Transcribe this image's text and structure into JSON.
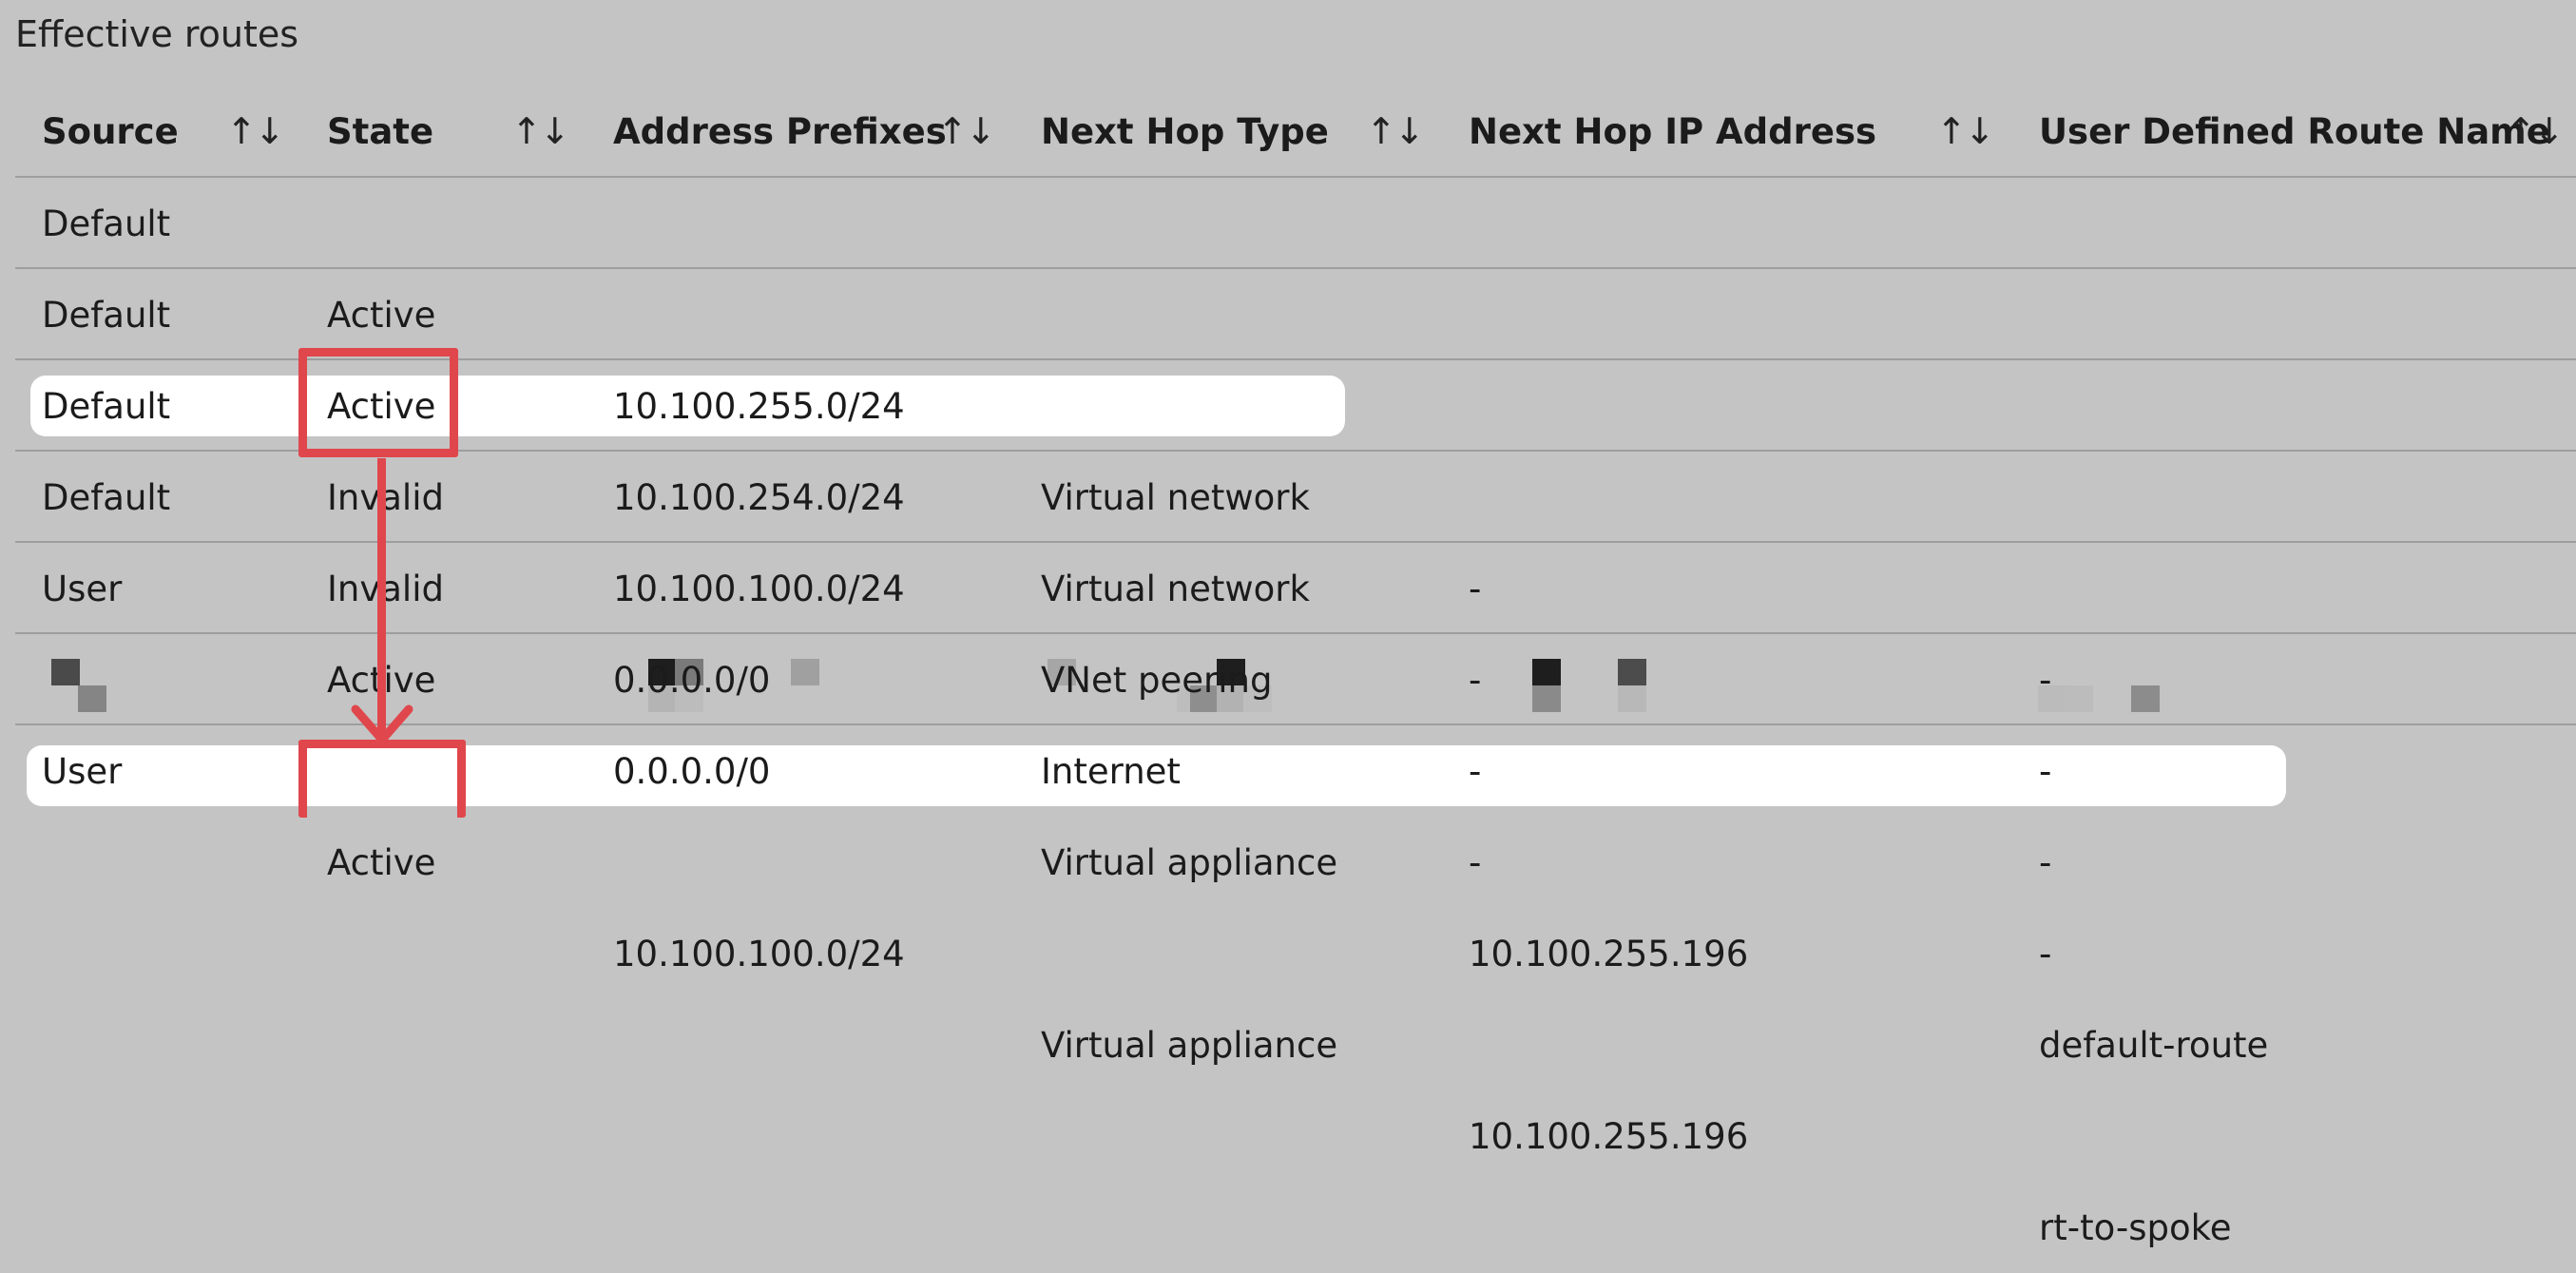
{
  "panel": {
    "title": "Effective routes"
  },
  "columns": [
    {
      "label": "Source"
    },
    {
      "label": "State"
    },
    {
      "label": "Address Prefixes"
    },
    {
      "label": "Next Hop Type"
    },
    {
      "label": "Next Hop IP Address"
    },
    {
      "label": "User Defined Route Name"
    }
  ],
  "sort_glyph": "↑↓",
  "rows": [
    {
      "source": "Default",
      "state": "Active",
      "prefix": "10.100.255.0/24",
      "next_hop_type": "Virtual network",
      "next_hop_ip": "-",
      "udr_name": "-"
    },
    {
      "source": "Default",
      "state": "Active",
      "prefix": "10.100.254.0/24",
      "next_hop_type": "Virtual network",
      "next_hop_ip": "-",
      "udr_name": "-"
    },
    {
      "source": "Default",
      "state": "Invalid",
      "prefix": "10.100.100.0/24",
      "next_hop_type": "VNet peering",
      "next_hop_ip": "-",
      "udr_name": "-"
    },
    {
      "source": "Default",
      "state": "Invalid",
      "prefix": "0.0.0.0/0",
      "next_hop_type": "Internet",
      "next_hop_ip": "-",
      "udr_name": "-"
    },
    {
      "source": "User",
      "state": "Active",
      "prefix": "0.0.0.0/0",
      "next_hop_type": "Virtual appliance",
      "next_hop_ip": "10.100.255.196",
      "udr_name": "default-route"
    },
    {
      "source": "",
      "state": "",
      "prefix": "",
      "next_hop_type": "",
      "next_hop_ip": "",
      "udr_name": ""
    },
    {
      "source": "User",
      "state": "Active",
      "prefix": "10.100.100.0/24",
      "next_hop_type": "Virtual appliance",
      "next_hop_ip": "10.100.255.196",
      "udr_name": "rt-to-spoke"
    }
  ],
  "annotation_color": "#e0474c"
}
